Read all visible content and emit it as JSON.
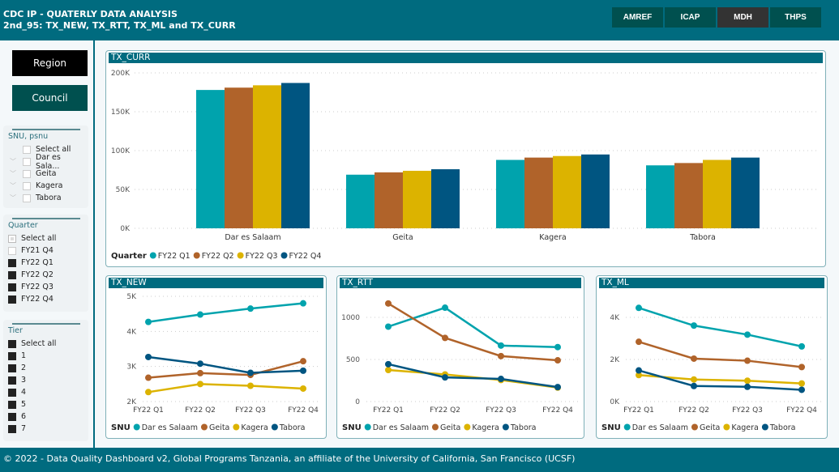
{
  "header": {
    "title": "CDC IP - QUATERLY DATA ANALYSIS",
    "subtitle": "2nd_95: TX_NEW, TX_RTT, TX_ML and TX_CURR",
    "orgs": [
      "AMREF",
      "ICAP",
      "MDH",
      "THPS"
    ],
    "active_org": "MDH"
  },
  "nav": {
    "region": "Region",
    "council": "Council"
  },
  "slicers": {
    "snu": {
      "title": "SNU, psnu",
      "items": [
        {
          "label": "Select all",
          "checked": false
        },
        {
          "label": "Dar es Sala...",
          "checked": false
        },
        {
          "label": "Geita",
          "checked": false
        },
        {
          "label": "Kagera",
          "checked": false
        },
        {
          "label": "Tabora",
          "checked": false
        }
      ]
    },
    "quarter": {
      "title": "Quarter",
      "items": [
        {
          "label": "Select all",
          "checked": "partial"
        },
        {
          "label": "FY21 Q4",
          "checked": false
        },
        {
          "label": "FY22 Q1",
          "checked": true
        },
        {
          "label": "FY22 Q2",
          "checked": true
        },
        {
          "label": "FY22 Q3",
          "checked": true
        },
        {
          "label": "FY22 Q4",
          "checked": true
        }
      ]
    },
    "tier": {
      "title": "Tier",
      "items": [
        {
          "label": "Select all",
          "checked": true
        },
        {
          "label": "1",
          "checked": true
        },
        {
          "label": "2",
          "checked": true
        },
        {
          "label": "3",
          "checked": true
        },
        {
          "label": "4",
          "checked": true
        },
        {
          "label": "5",
          "checked": true
        },
        {
          "label": "6",
          "checked": true
        },
        {
          "label": "7",
          "checked": true
        }
      ]
    }
  },
  "colors": {
    "s1": "#00a3ad",
    "s2": "#b0632a",
    "s3": "#dcb300",
    "s4": "#005581",
    "header": "#006b7f"
  },
  "chart_data": [
    {
      "type": "bar",
      "title": "TX_CURR",
      "categories": [
        "Dar es Salaam",
        "Geita",
        "Kagera",
        "Tabora"
      ],
      "legend_title": "Quarter",
      "ylim": [
        0,
        200000
      ],
      "yticks": [
        "0K",
        "50K",
        "100K",
        "150K",
        "200K"
      ],
      "grid": true,
      "legend": "bottom-left",
      "series": [
        {
          "name": "FY22 Q1",
          "values": [
            178000,
            69000,
            88000,
            81000
          ]
        },
        {
          "name": "FY22 Q2",
          "values": [
            181000,
            72000,
            91000,
            84000
          ]
        },
        {
          "name": "FY22 Q3",
          "values": [
            184000,
            74000,
            93000,
            88000
          ]
        },
        {
          "name": "FY22 Q4",
          "values": [
            187000,
            76000,
            95000,
            91000
          ]
        }
      ]
    },
    {
      "type": "line",
      "title": "TX_NEW",
      "categories": [
        "FY22 Q1",
        "FY22 Q2",
        "FY22 Q3",
        "FY22 Q4"
      ],
      "legend_title": "SNU",
      "ylim": [
        2000,
        5000
      ],
      "yticks": [
        "2K",
        "3K",
        "4K",
        "5K"
      ],
      "tickvals": [
        2000,
        3000,
        4000,
        5000
      ],
      "grid": true,
      "legend": "bottom-left",
      "series": [
        {
          "name": "Dar es Salaam",
          "values": [
            4270,
            4480,
            4650,
            4800
          ]
        },
        {
          "name": "Geita",
          "values": [
            2680,
            2810,
            2760,
            3150
          ]
        },
        {
          "name": "Kagera",
          "values": [
            2270,
            2500,
            2450,
            2370
          ]
        },
        {
          "name": "Tabora",
          "values": [
            3270,
            3080,
            2820,
            2880
          ]
        }
      ]
    },
    {
      "type": "line",
      "title": "TX_RTT",
      "categories": [
        "FY22 Q1",
        "FY22 Q2",
        "FY22 Q3",
        "FY22 Q4"
      ],
      "legend_title": "SNU",
      "ylim": [
        0,
        1250
      ],
      "yticks": [
        "0",
        "500",
        "1000"
      ],
      "tickvals": [
        0,
        500,
        1000
      ],
      "grid": true,
      "legend": "bottom-left",
      "series": [
        {
          "name": "Dar es Salaam",
          "values": [
            890,
            1115,
            665,
            647
          ]
        },
        {
          "name": "Geita",
          "values": [
            1165,
            756,
            540,
            490
          ]
        },
        {
          "name": "Kagera",
          "values": [
            375,
            322,
            256,
            166
          ]
        },
        {
          "name": "Tabora",
          "values": [
            444,
            287,
            269,
            172
          ]
        }
      ]
    },
    {
      "type": "line",
      "title": "TX_ML",
      "categories": [
        "FY22 Q1",
        "FY22 Q2",
        "FY22 Q3",
        "FY22 Q4"
      ],
      "legend_title": "SNU",
      "ylim": [
        0,
        5000
      ],
      "yticks": [
        "0K",
        "2K",
        "4K"
      ],
      "tickvals": [
        0,
        2000,
        4000
      ],
      "grid": true,
      "legend": "bottom-left",
      "series": [
        {
          "name": "Dar es Salaam",
          "values": [
            4450,
            3610,
            3180,
            2620
          ]
        },
        {
          "name": "Geita",
          "values": [
            2840,
            2040,
            1940,
            1640
          ]
        },
        {
          "name": "Kagera",
          "values": [
            1260,
            1050,
            990,
            860
          ]
        },
        {
          "name": "Tabora",
          "values": [
            1480,
            740,
            700,
            560
          ]
        }
      ]
    }
  ],
  "footer": "© 2022 - Data Quality Dashboard v2, Global Programs Tanzania, an affiliate of the University of California, San Francisco (UCSF)"
}
